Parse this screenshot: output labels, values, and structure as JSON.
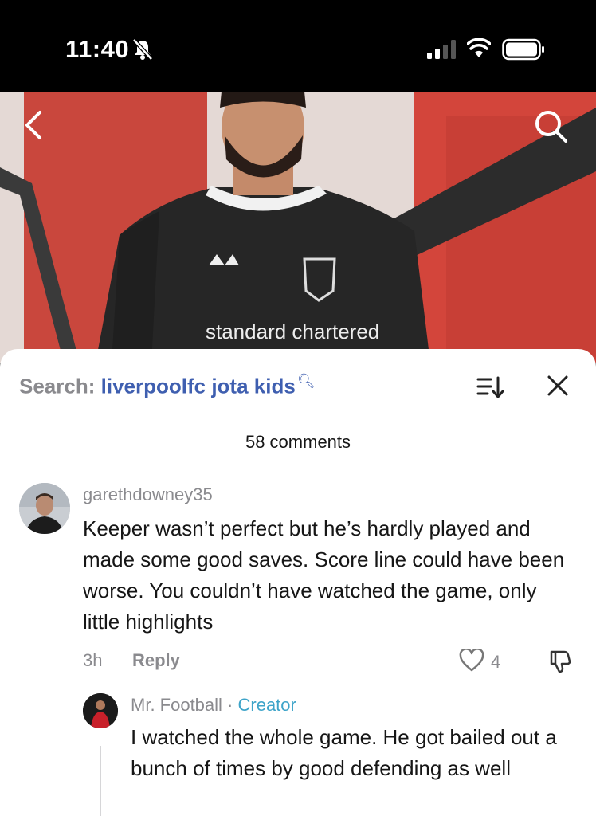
{
  "status_bar": {
    "time": "11:40",
    "icons": [
      "bell-slash-icon",
      "signal-icon",
      "wifi-icon",
      "battery-icon"
    ]
  },
  "hero": {
    "nav_icons": [
      "chevron-left-icon",
      "search-icon"
    ],
    "shirt_sponsor": "standard chartered"
  },
  "comments_sheet": {
    "search_prefix": "Search:",
    "search_term": "liverpoolfc jota kids",
    "count_label": "58 comments",
    "header_icons": [
      "sort-icon",
      "close-icon"
    ],
    "comments": [
      {
        "username": "garethdowney35",
        "text": "Keeper wasn’t perfect but he’s hardly played and made some good saves. Score line could have been worse. You couldn’t have watched the game, only little highlights",
        "age": "3h",
        "reply_label": "Reply",
        "likes": "4"
      }
    ],
    "reply": {
      "username": "Mr. Football",
      "separator": " · ",
      "badge": "Creator",
      "text": "I watched the whole game. He got bailed out a bunch of times by good defending as well"
    }
  },
  "colors": {
    "accent_search": "#3f5fb0",
    "creator_badge": "#3ea4c9",
    "muted_text": "#8a8a8e",
    "body_text": "#161616"
  }
}
